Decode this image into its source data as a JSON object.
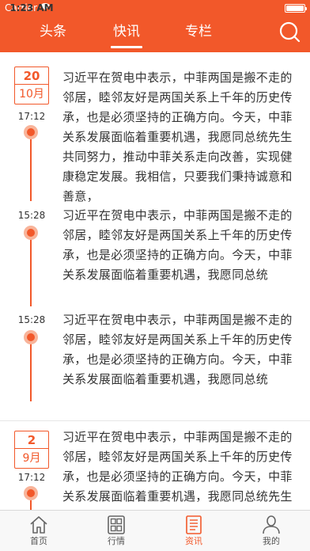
{
  "status_bar": {
    "carrier": "Carrier",
    "time": "1:23 AM"
  },
  "nav": {
    "tabs": [
      {
        "label": "头条"
      },
      {
        "label": "快讯",
        "active": true
      },
      {
        "label": "专栏"
      }
    ],
    "search_icon": "search-icon"
  },
  "timeline": [
    {
      "date_day": "20",
      "date_month": "10月",
      "time": "17:12",
      "text": "习近平在贺电中表示，中菲两国是搬不走的邻居，睦邻友好是两国关系上千年的历史传承，也是必须坚持的正确方向。今天，中菲关系发展面临着重要机遇，我愿同总统先生共同努力，推动中菲关系走向改善，实现健康稳定发展。我相信，只要我们秉持诚意和善意，"
    },
    {
      "time": "15:28",
      "text": "习近平在贺电中表示，中菲两国是搬不走的邻居，睦邻友好是两国关系上千年的历史传承，也是必须坚持的正确方向。今天，中菲关系发展面临着重要机遇，我愿同总统"
    },
    {
      "time": "15:28",
      "text": "习近平在贺电中表示，中菲两国是搬不走的邻居，睦邻友好是两国关系上千年的历史传承，也是必须坚持的正确方向。今天，中菲关系发展面临着重要机遇，我愿同总统"
    },
    {
      "date_day": "2",
      "date_month": "9月",
      "time": "17:12",
      "text": "习近平在贺电中表示，中菲两国是搬不走的邻居，睦邻友好是两国关系上千年的历史传承，也是必须坚持的正确方向。今天，中菲关系发展面临着重要机遇，我愿同总统先生共同努力，推动中菲关系走向改善"
    }
  ],
  "tabbar": {
    "items": [
      {
        "label": "首页",
        "icon": "home-icon"
      },
      {
        "label": "行情",
        "icon": "grid-icon"
      },
      {
        "label": "资讯",
        "icon": "news-icon",
        "active": true
      },
      {
        "label": "我的",
        "icon": "person-icon"
      }
    ]
  },
  "colors": {
    "accent": "#f2582a",
    "dot_halo": "#f8b49a",
    "text": "#333333"
  }
}
